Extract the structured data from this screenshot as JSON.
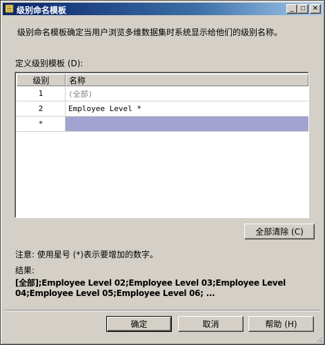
{
  "window": {
    "title": "级别命名模板",
    "min_glyph": "_",
    "max_glyph": "□",
    "close_glyph": "✕"
  },
  "description": "级别命名模板确定当用户浏览多维数据集时系统显示给他们的级别名称。",
  "grid": {
    "label": "定义级别模板 (D):",
    "columns": [
      "级别",
      "名称"
    ],
    "rows": [
      {
        "level": "1",
        "name": "(全部)"
      },
      {
        "level": "2",
        "name": "Employee Level *"
      },
      {
        "level": "*",
        "name": ""
      }
    ]
  },
  "clear_button": "全部清除 (C)",
  "note": "注意: 使用星号 (*)表示要增加的数字。",
  "result_label": "结果:",
  "result_text": "[全部];Employee Level 02;Employee Level 03;Employee Level 04;Employee Level 05;Employee Level 06; ...",
  "buttons": {
    "ok": "确定",
    "cancel": "取消",
    "help": "帮助 (H)"
  },
  "colors": {
    "title_bar": "#0a246a",
    "selection": "#a3a3d1",
    "face": "#d4d0c8"
  },
  "icons": {
    "title": "dialog-icon"
  }
}
